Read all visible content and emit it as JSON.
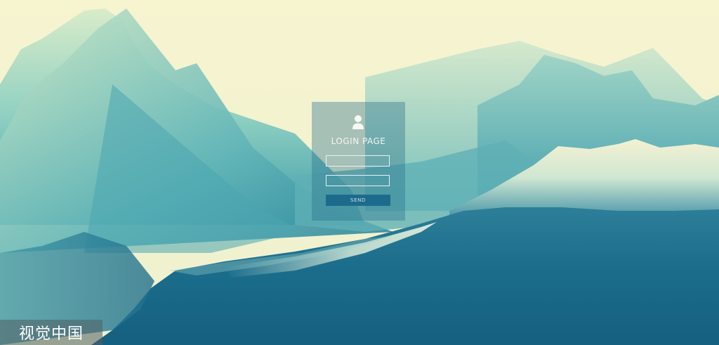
{
  "login": {
    "title": "LOGIN PAGE",
    "username_value": "",
    "password_value": "",
    "send_label": "SEND"
  },
  "icons": {
    "user": "user-icon"
  },
  "watermark": {
    "text": "视觉中国"
  },
  "colors": {
    "sky": "#f6f3cf",
    "mountain_dark": "#1a6a8a",
    "mountain_light": "#7cc6c2",
    "button": "#1d6b8c"
  }
}
